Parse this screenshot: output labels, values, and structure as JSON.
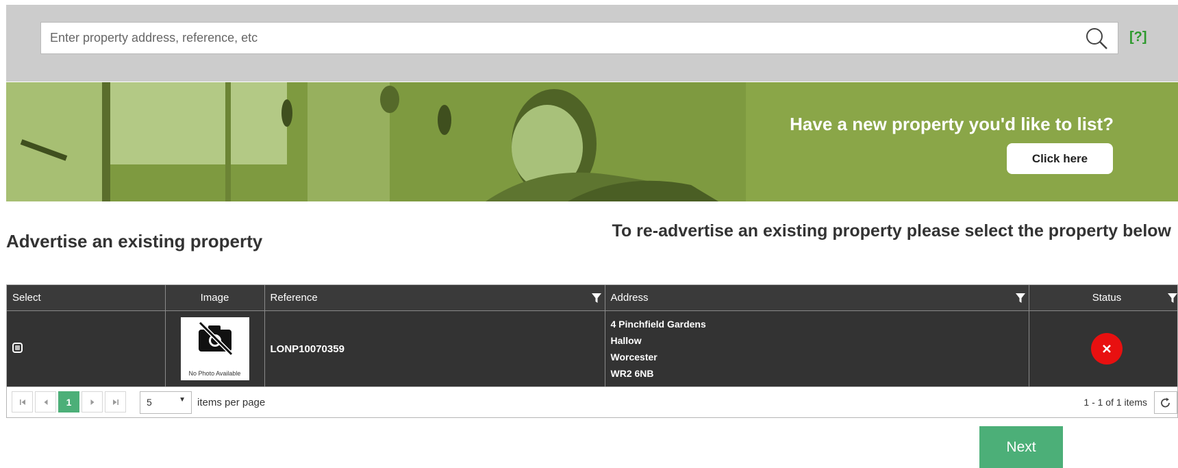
{
  "search": {
    "placeholder": "Enter property address, reference, etc",
    "help_label": "[?]"
  },
  "banner": {
    "title": "Have a new property you'd like to list?",
    "button_label": "Click here",
    "background_color": "#8aa648"
  },
  "section": {
    "title": "Advertise an existing property",
    "instruction": "To re-advertise an existing property please select the property below"
  },
  "grid": {
    "columns": {
      "select": "Select",
      "image": "Image",
      "reference": "Reference",
      "address": "Address",
      "status": "Status"
    },
    "rows": [
      {
        "selected": false,
        "image_text": "No Photo Available",
        "reference": "LONP10070359",
        "address_lines": [
          "4 Pinchfield Gardens",
          "Hallow",
          "Worcester",
          "WR2 6NB"
        ],
        "status_icon": "close-icon",
        "status_color": "#e81010"
      }
    ]
  },
  "pager": {
    "current_page": "1",
    "page_size": "5",
    "items_per_page_label": "items per page",
    "info": "1 - 1 of 1 items"
  },
  "footer": {
    "next_label": "Next",
    "accent_color": "#4caf78"
  }
}
